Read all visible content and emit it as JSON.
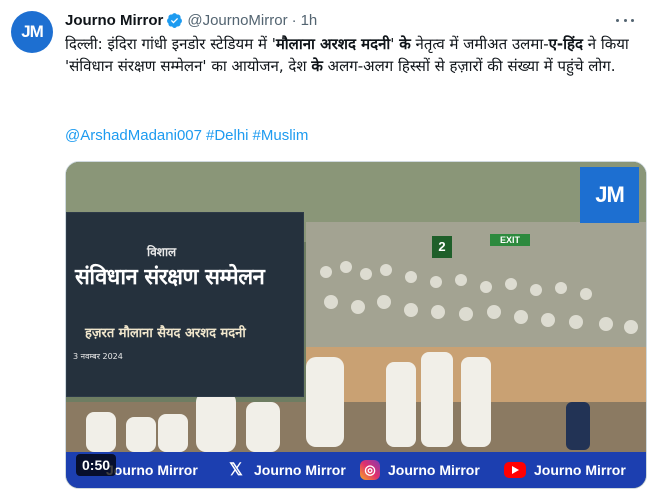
{
  "account": {
    "display_name": "Journo Mirror",
    "handle": "@JournoMirror",
    "separator": "·",
    "time": "1h",
    "avatar_logo": "JM",
    "verified_icon": "verified-badge-icon"
  },
  "tweet": {
    "text_part1": "दिल्ली: इंदिरा गांधी इनडोर स्टेडियम में '",
    "text_bold1": "मौलाना अरशद मदनी",
    "text_part2": "' ",
    "text_bold2": "के",
    "text_part3": " नेतृत्व में जमीअत उलमा-",
    "text_bold3": "ए-हिंद",
    "text_part4": " ने किया 'संविधान संरक्षण सम्मेलन' का आयोजन, देश ",
    "text_bold4": "के",
    "text_part5": " अलग-अलग हिस्सों से हज़ारों की संख्या में पहुंचे लोग.",
    "hashtags": [
      "@ArshadMadani007",
      "#Delhi",
      "#Muslim"
    ]
  },
  "media": {
    "duration": "0:50",
    "corner_logo": "JM",
    "banner_small": "विशाल",
    "banner_title": "संविधान संरक्षण सम्मेलन",
    "banner_name": "हज़रत मौलाना सैयद अरशद मदनी",
    "banner_date": "3 नवम्बर 2024",
    "exit_sign": "EXIT",
    "gate_number": "2",
    "footer": [
      {
        "icon": "x-logo-icon",
        "label": "Journo Mirror"
      },
      {
        "icon": "instagram-icon",
        "label": "Journo Mirror"
      },
      {
        "icon": "youtube-icon",
        "label": "Journo Mirror"
      }
    ],
    "footer_first_label": "Journo Mirror"
  }
}
